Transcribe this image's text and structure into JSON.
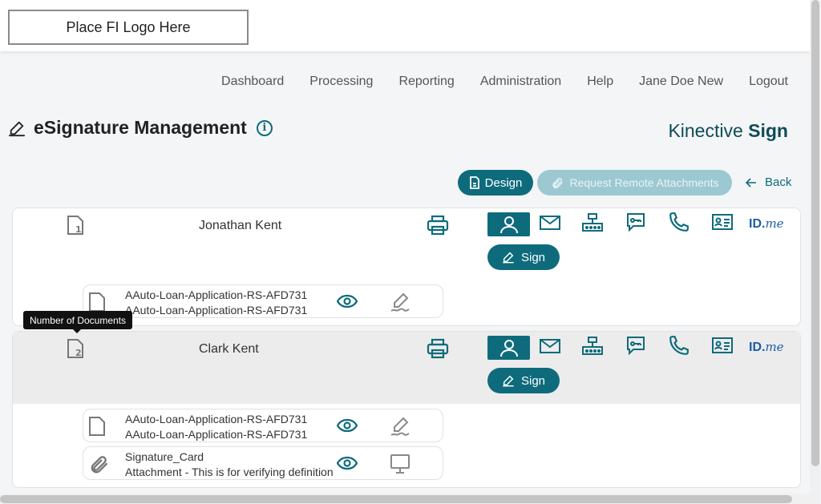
{
  "header": {
    "logo_text": "Place FI Logo Here"
  },
  "nav": {
    "items": [
      "Dashboard",
      "Processing",
      "Reporting",
      "Administration",
      "Help",
      "Jane Doe New",
      "Logout"
    ]
  },
  "page": {
    "title": "eSignature Management",
    "info_icon": "i"
  },
  "brand": {
    "prefix": "Kinective",
    "suffix": "Sign"
  },
  "actions": {
    "design_label": "Design",
    "remote_label": "Request Remote Attachments",
    "back_label": "Back"
  },
  "colors": {
    "primary": "#0e6b7c",
    "primary_disabled": "#9cc9d1",
    "idme": "#1b5ea8"
  },
  "signers": [
    {
      "name": "Jonathan Kent",
      "doc_count": "1",
      "sign_label": "Sign",
      "auth_icons": [
        "user-icon",
        "mail-icon",
        "router-icon",
        "key-message-icon",
        "phone-icon",
        "id-card-icon",
        "idme-logo"
      ],
      "documents": [
        {
          "type": "document",
          "line1": "AAuto-Loan-Application-RS-AFD731",
          "line2": "AAuto-Loan-Application-RS-AFD731",
          "action_icon": "signature-icon"
        }
      ]
    },
    {
      "name": "Clark Kent",
      "doc_count": "2",
      "sign_label": "Sign",
      "auth_icons": [
        "user-icon",
        "mail-icon",
        "router-icon",
        "key-message-icon",
        "phone-icon",
        "id-card-icon",
        "idme-logo"
      ],
      "documents": [
        {
          "type": "document",
          "line1": "AAuto-Loan-Application-RS-AFD731",
          "line2": "AAuto-Loan-Application-RS-AFD731",
          "action_icon": "signature-icon"
        },
        {
          "type": "attachment",
          "line1": "Signature_Card",
          "line2": "Attachment - This is for verifying definition",
          "action_icon": "monitor-icon"
        }
      ]
    }
  ],
  "idme": {
    "id": "ID.",
    "me": "me"
  },
  "tooltip": {
    "text": "Number of Documents"
  }
}
